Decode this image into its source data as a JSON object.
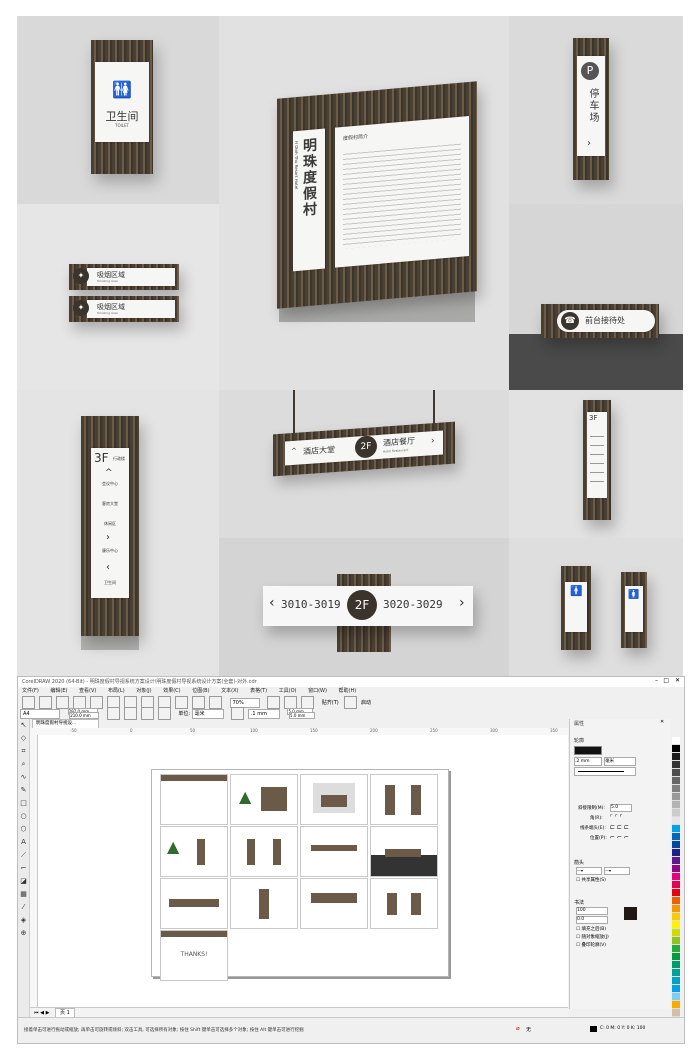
{
  "mockups": {
    "toilet": {
      "title": "卫生间",
      "subtitle": "TOILET"
    },
    "parking": {
      "letter": "P",
      "label": "停车场"
    },
    "main": {
      "vertical_title": "明珠度假村",
      "vertical_subtitle": "H Dinh Thu Resort Hotel",
      "board_title": "度假村简介"
    },
    "area_signs": [
      {
        "label": "吸烟区域",
        "sub": "Smoking Area"
      },
      {
        "label": "吸烟区域",
        "sub": "Smoking Area"
      }
    ],
    "reception": {
      "label": "前台接待处"
    },
    "directory": {
      "floor": "3F",
      "floor_sub": "行政楼",
      "items": [
        "会议中心",
        "客房大堂",
        "休闲区",
        "康乐中心",
        "卫生间"
      ]
    },
    "hanging": {
      "left": "酒店大堂",
      "floor": "2F",
      "right": "酒店餐厅",
      "right_sub": "Hotel Restaurant"
    },
    "room_sign": {
      "left": "3010-3019",
      "floor": "2F",
      "right": "3020-3029"
    },
    "directory_small": {
      "floor": "3F"
    }
  },
  "app": {
    "title": "CorelDRAW 2020 (64-Bit) - 明珠度假村导视系统方案设计\\明珠度假村导视系统设计方案(全套)-对外.cdr",
    "menu": [
      "文件(F)",
      "编辑(E)",
      "查看(V)",
      "布局(L)",
      "对象(J)",
      "效果(C)",
      "位图(B)",
      "文本(X)",
      "表格(T)",
      "工具(O)",
      "窗口(W)",
      "帮助(H)"
    ],
    "toolbar": {
      "zoom": "70%",
      "snap": "贴齐(T)",
      "launch": "启动"
    },
    "property_bar": {
      "page_size": "A4",
      "width": "297.0 mm",
      "height": "210.0 mm",
      "unit_label": "单位:",
      "unit": "毫米",
      "nudge": ".1 mm",
      "dup_x": "5.0 mm",
      "dup_y": "5.0 mm"
    },
    "doc_tab": "明珠度假村导视设...",
    "page_tab": "页 1",
    "thanks_text": "THANKS!",
    "status": {
      "hint": "接着单击可进行拖动或缩放; 再单击可旋转或倾斜; 双击工具, 可选择所有对象; 按住 Shift 键单击可选择多个对象; 按住 Alt 键单击可进行挖掘",
      "fill_label": "无",
      "color_readout": "C: 0 M: 0 Y: 0 K: 100"
    },
    "docker": {
      "title": "属性",
      "outline_label": "轮廓",
      "width_value": ".2 mm",
      "width_unit": "毫米",
      "miter_label": "斜接限制(M):",
      "miter_value": "5.0",
      "corners_label": "角(R):",
      "joins_label": "线条端头(E):",
      "position_label": "位置(P):",
      "arrows_label": "箭头",
      "share_label": "共享属性(S)",
      "calligraphy_label": "书法",
      "stretch_value": "100",
      "angle_value": "0.0",
      "behind_fill": "填充之后(B)",
      "scale_with_object": "随对象缩放(J)",
      "overprint": "叠印轮廓(V)"
    },
    "ruler_numbers": [
      "-50",
      "0",
      "50",
      "100",
      "150",
      "200",
      "250",
      "300",
      "350"
    ],
    "palette_colors": [
      "#ffffff",
      "#000000",
      "#1a1a1a",
      "#333333",
      "#4d4d4d",
      "#666666",
      "#808080",
      "#999999",
      "#b3b3b3",
      "#cccccc",
      "#e6e6e6",
      "#00a0e9",
      "#0068b7",
      "#00479d",
      "#1d2088",
      "#601986",
      "#920783",
      "#e4007f",
      "#e5004f",
      "#e60012",
      "#eb6100",
      "#f39800",
      "#fcc800",
      "#fff100",
      "#cfdb00",
      "#8fc31f",
      "#22ac38",
      "#009944",
      "#009b6b",
      "#009e96",
      "#00a0c1",
      "#00a0e9",
      "#7ecef4",
      "#f7ab00",
      "#d1c0a5",
      "#8c6239",
      "#603813",
      "#c7b299"
    ]
  }
}
